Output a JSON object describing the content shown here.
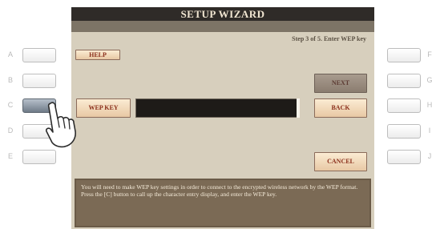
{
  "left_panel_buttons": [
    {
      "letter": "A"
    },
    {
      "letter": "B"
    },
    {
      "letter": "C",
      "pressed": true
    },
    {
      "letter": "D"
    },
    {
      "letter": "E"
    }
  ],
  "right_panel_buttons": [
    {
      "letter": "F"
    },
    {
      "letter": "G"
    },
    {
      "letter": "H"
    },
    {
      "letter": "I"
    },
    {
      "letter": "J"
    }
  ],
  "wizard": {
    "title": "SETUP WIZARD",
    "step_text": "Step 3 of 5. Enter WEP key",
    "help_label": "HELP",
    "wep_key_label": "WEP KEY",
    "wep_key_value": "",
    "next_label": "NEXT",
    "back_label": "BACK",
    "cancel_label": "CANCEL",
    "info_lines": [
      "You will need to make WEP key settings in order to connect to the encrypted wireless network by the WEP format.",
      "Press the [C] button to call up the character entry display, and enter the WEP key."
    ]
  },
  "colors": {
    "title_bar": "#2f2b28",
    "panel_bg": "#d7cfbd",
    "info_bg": "#7b6a55",
    "button_text": "#8b2f1b"
  },
  "icons": [
    "pointing-hand-icon"
  ]
}
